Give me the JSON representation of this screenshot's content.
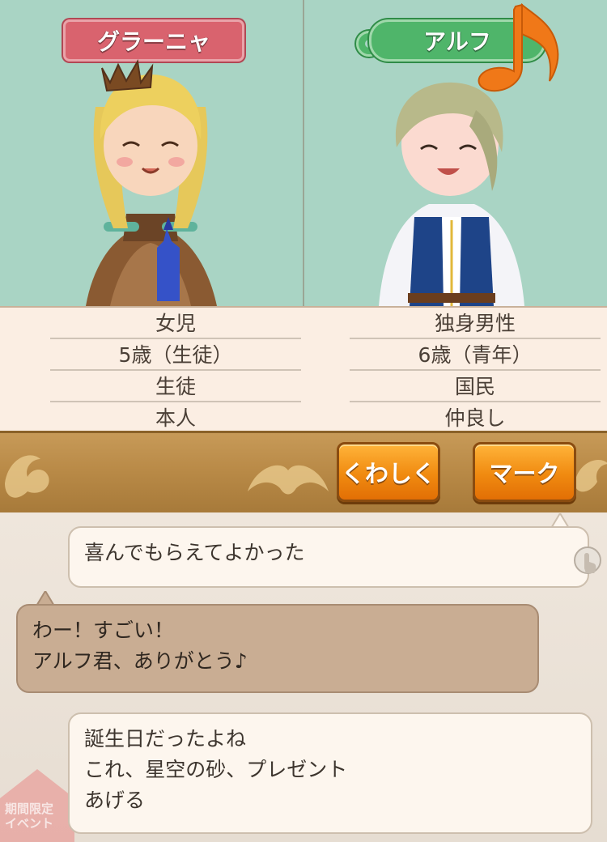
{
  "characters": {
    "left": {
      "name": "グラーニャ",
      "info": [
        "女児",
        "5歳（生徒）",
        "生徒",
        "本人"
      ]
    },
    "right": {
      "name": "アルフ",
      "info": [
        "独身男性",
        "6歳（青年）",
        "国民",
        "仲良し"
      ]
    }
  },
  "buttons": {
    "detail": "くわしく",
    "mark": "マーク"
  },
  "chat": {
    "line1": "喜んでもらえてよかった",
    "line2a": "わー！すごい！",
    "line2b": "アルフ君、ありがとう♪",
    "line3a": "誕生日だったよね",
    "line3b": "これ、星空の砂、プレゼント",
    "line3c": "あげる"
  },
  "background_badge": {
    "line1": "期間限定",
    "line2": "イベント"
  },
  "colors": {
    "top_bg": "#a9d4c4",
    "left_name": "#d9636e",
    "right_name": "#4fb56a",
    "button": "#f08a10"
  }
}
